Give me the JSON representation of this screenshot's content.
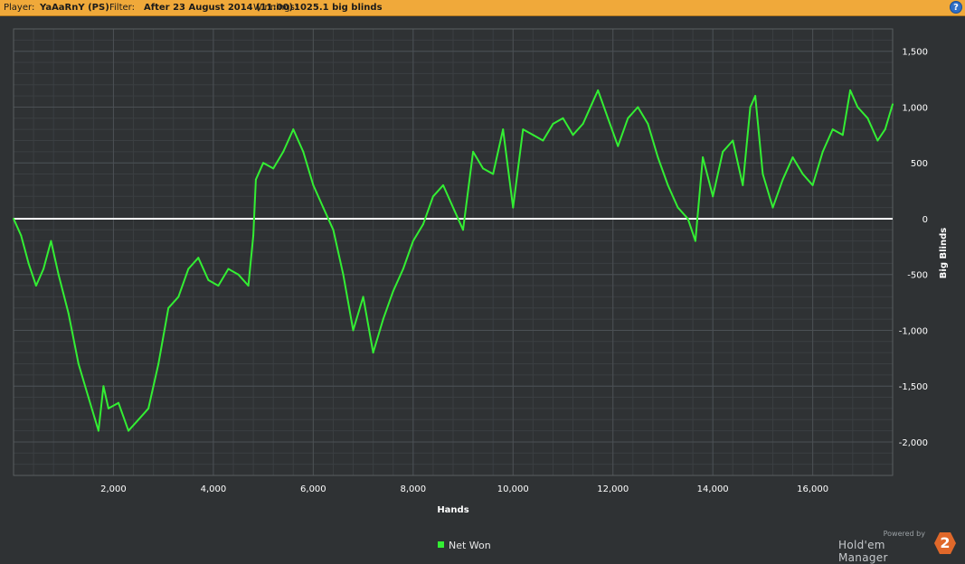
{
  "header": {
    "player_label": "Player:",
    "player_value": "YaAaRnY (PS)",
    "filter_label": "Filter:",
    "filter_value": "After 23 August 2014 (11:00)",
    "winnings_label": "Winnings:",
    "winnings_value": "1025.1 big blinds",
    "help_glyph": "?"
  },
  "legend": {
    "net_won": "Net Won"
  },
  "branding": {
    "powered_by": "Powered by",
    "product": "Hold'em Manager",
    "logo_digit": "2"
  },
  "colors": {
    "line": "#33ee33",
    "zero_line": "#ffffff",
    "background": "#2f3234",
    "header": "#f0a93a"
  },
  "chart_data": {
    "type": "line",
    "xlabel": "Hands",
    "ylabel": "Big Blinds",
    "xlim": [
      0,
      17600
    ],
    "ylim": [
      -2300,
      1700
    ],
    "x_ticks": [
      2000,
      4000,
      6000,
      8000,
      10000,
      12000,
      14000,
      16000
    ],
    "x_tick_labels": [
      "2,000",
      "4,000",
      "6,000",
      "8,000",
      "10,000",
      "12,000",
      "14,000",
      "16,000"
    ],
    "y_ticks": [
      1500,
      1000,
      500,
      0,
      -500,
      -1000,
      -1500,
      -2000
    ],
    "y_tick_labels": [
      "1,500",
      "1,000",
      "500",
      "0",
      "-500",
      "-1,000",
      "-1,500",
      "-2,000"
    ],
    "grid": true,
    "legend_position": "bottom-center",
    "series": [
      {
        "name": "Net Won",
        "x": [
          0,
          150,
          300,
          450,
          600,
          750,
          900,
          1100,
          1300,
          1500,
          1700,
          1800,
          1900,
          2100,
          2300,
          2500,
          2700,
          2900,
          3100,
          3300,
          3500,
          3700,
          3900,
          4100,
          4300,
          4500,
          4700,
          4800,
          4850,
          5000,
          5200,
          5400,
          5600,
          5800,
          6000,
          6200,
          6400,
          6600,
          6800,
          7000,
          7200,
          7400,
          7600,
          7800,
          8000,
          8200,
          8400,
          8600,
          8800,
          9000,
          9200,
          9400,
          9600,
          9800,
          10000,
          10200,
          10400,
          10600,
          10800,
          11000,
          11200,
          11400,
          11600,
          11700,
          11900,
          12100,
          12300,
          12500,
          12700,
          12900,
          13100,
          13300,
          13500,
          13650,
          13800,
          14000,
          14200,
          14400,
          14600,
          14750,
          14850,
          15000,
          15200,
          15400,
          15600,
          15800,
          16000,
          16200,
          16400,
          16600,
          16750,
          16900,
          17100,
          17300,
          17450,
          17600
        ],
        "y": [
          0,
          -150,
          -400,
          -600,
          -450,
          -200,
          -500,
          -850,
          -1300,
          -1600,
          -1900,
          -1500,
          -1700,
          -1650,
          -1900,
          -1800,
          -1700,
          -1300,
          -800,
          -700,
          -450,
          -350,
          -550,
          -600,
          -450,
          -500,
          -600,
          -150,
          350,
          500,
          450,
          600,
          800,
          600,
          300,
          100,
          -100,
          -500,
          -1000,
          -700,
          -1200,
          -900,
          -650,
          -450,
          -200,
          -50,
          200,
          300,
          100,
          -100,
          600,
          450,
          400,
          800,
          100,
          800,
          750,
          700,
          850,
          900,
          750,
          850,
          1050,
          1150,
          900,
          650,
          900,
          1000,
          850,
          550,
          300,
          100,
          0,
          -200,
          550,
          200,
          600,
          700,
          300,
          1000,
          1100,
          400,
          100,
          350,
          550,
          400,
          300,
          600,
          800,
          750,
          1150,
          1000,
          900,
          700,
          800,
          1025
        ]
      }
    ]
  }
}
